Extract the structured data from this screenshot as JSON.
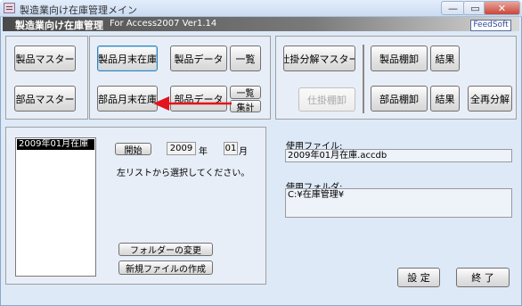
{
  "window": {
    "title": "製造業向け在庫管理メイン",
    "min": "—",
    "max": "▭",
    "close": "✕"
  },
  "header": {
    "title": "製造業向け在庫管理",
    "subtitle": "For Access2007    Ver1.14",
    "brand": "FeedSoft"
  },
  "left_buttons": {
    "product_master": "製品マスター",
    "part_master": "部品マスター",
    "product_month_stock": "製品月末在庫",
    "part_month_stock": "部品月末在庫",
    "product_data": "製品データ",
    "part_data": "部品データ",
    "product_list": "一覧",
    "part_list": "一覧",
    "part_total": "集計"
  },
  "right_buttons": {
    "breakdown_master": "仕掛分解マスター",
    "wip_inventory": "仕掛棚卸",
    "product_inventory": "製品棚卸",
    "product_result": "結果",
    "part_inventory": "部品棚卸",
    "part_result": "結果",
    "full_breakdown": "全再分解"
  },
  "list_panel": {
    "items": [
      "2009年01月在庫"
    ],
    "start_button": "開始",
    "year_value": "2009",
    "year_unit": "年",
    "month_value": "01",
    "month_unit": "月",
    "instruction": "左リストから選択してください。",
    "change_folder": "フォルダーの変更",
    "new_file": "新規ファイルの作成"
  },
  "file_info": {
    "file_label": "使用ファイル:",
    "file_value": "2009年01月在庫.accdb",
    "folder_label": "使用フォルダ:",
    "folder_value": "C:¥在庫管理¥"
  },
  "footer": {
    "settings": "設 定",
    "exit": "終 了"
  },
  "colors": {
    "header_bg": "#4a4a4a",
    "window_bg": "#dde9f7",
    "arrow": "#e3141e"
  }
}
